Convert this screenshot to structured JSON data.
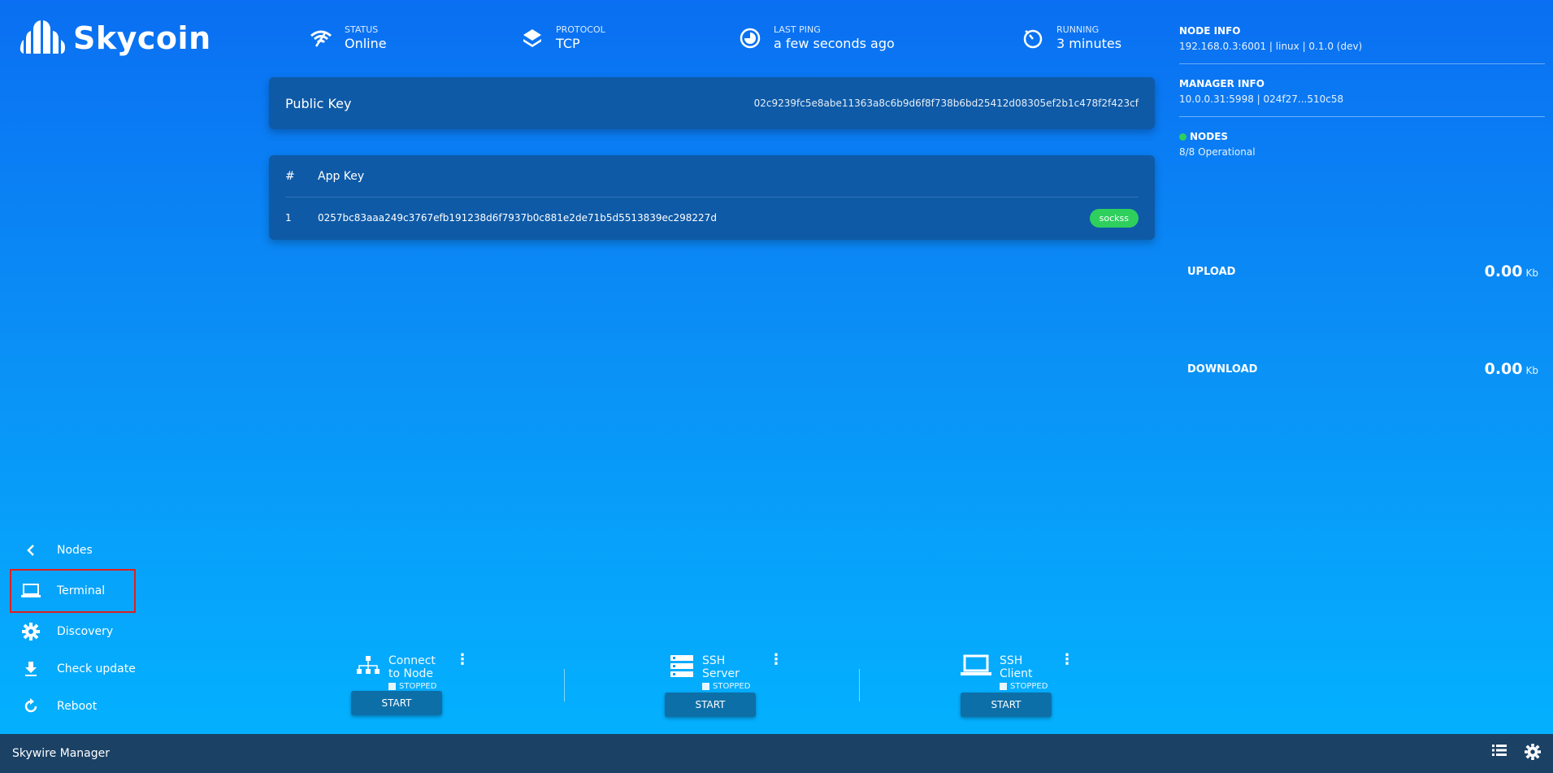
{
  "brand": {
    "name": "Skycoin"
  },
  "stats": {
    "status": {
      "label": "STATUS",
      "value": "Online",
      "icon": "wifi-icon"
    },
    "protocol": {
      "label": "PROTOCOL",
      "value": "TCP",
      "icon": "layers-icon"
    },
    "last_ping": {
      "label": "LAST PING",
      "value": "a few seconds ago",
      "icon": "ping-icon"
    },
    "running": {
      "label": "RUNNING",
      "value": "3 minutes",
      "icon": "timer-icon"
    }
  },
  "public_key": {
    "label": "Public Key",
    "value": "02c9239fc5e8abe11363a8c6b9d6f8f738b6bd25412d08305ef2b1c478f2f423cf"
  },
  "apps_table": {
    "headers": [
      "#",
      "App Key"
    ],
    "rows": [
      {
        "num": "1",
        "key": "0257bc83aaa249c3767efb191238d6f7937b0c881e2de71b5d5513839ec298227d",
        "badge": "sockss"
      }
    ]
  },
  "node_info": {
    "title": "NODE INFO",
    "value": "192.168.0.3:6001 | linux | 0.1.0 (dev)"
  },
  "manager_info": {
    "title": "MANAGER INFO",
    "value": "10.0.0.31:5998 | 024f27...510c58"
  },
  "nodes": {
    "title": "NODES",
    "value": "8/8 Operational",
    "status_color": "#2fcf5e"
  },
  "traffic": {
    "upload": {
      "label": "UPLOAD",
      "value": "0.00",
      "unit": "Kb"
    },
    "download": {
      "label": "DOWNLOAD",
      "value": "0.00",
      "unit": "Kb"
    }
  },
  "menu": {
    "items": [
      {
        "label": "Nodes",
        "icon": "chevron-left-icon"
      },
      {
        "label": "Terminal",
        "icon": "laptop-icon"
      },
      {
        "label": "Discovery",
        "icon": "gear-icon"
      },
      {
        "label": "Check update",
        "icon": "download-icon"
      },
      {
        "label": "Reboot",
        "icon": "refresh-icon"
      }
    ]
  },
  "apps": [
    {
      "name": "Connect to Node",
      "status": "STOPPED",
      "button": "START",
      "icon": "network-icon"
    },
    {
      "name": "SSH Server",
      "status": "STOPPED",
      "button": "START",
      "icon": "server-icon"
    },
    {
      "name": "SSH Client",
      "status": "STOPPED",
      "button": "START",
      "icon": "laptop-icon"
    }
  ],
  "footer": {
    "title": "Skywire Manager",
    "icons": [
      "list-icon",
      "settings-icon"
    ]
  },
  "colors": {
    "card_bg": "#0e5aa7",
    "badge_green": "#2fcf5e",
    "footer_bg": "#1b4165",
    "highlight": "#e02020"
  }
}
